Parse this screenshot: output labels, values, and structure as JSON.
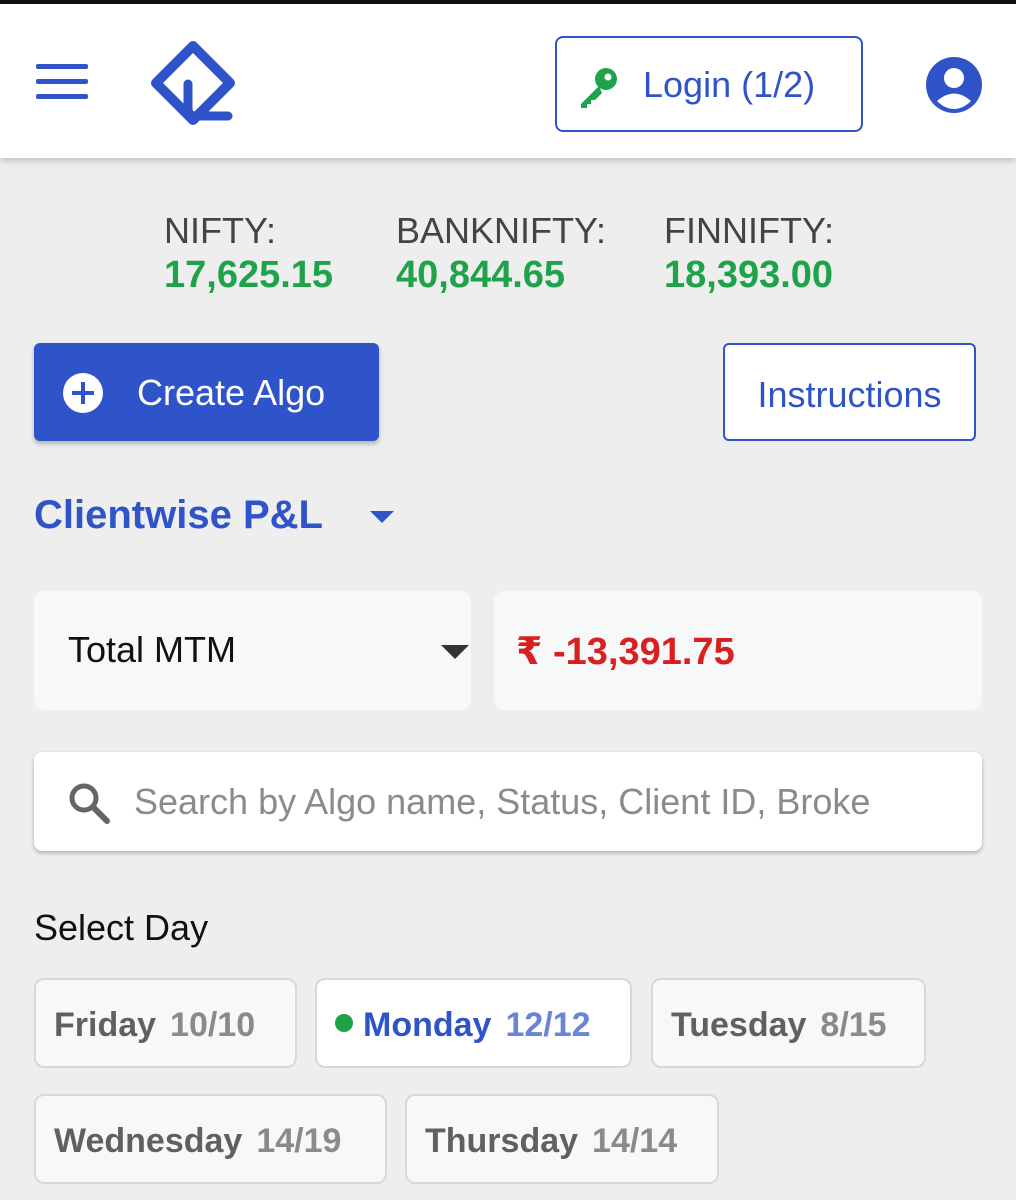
{
  "header": {
    "login_label": "Login (1/2)"
  },
  "indices": [
    {
      "name": "NIFTY:",
      "value": "17,625.15"
    },
    {
      "name": "BANKNIFTY:",
      "value": "40,844.65"
    },
    {
      "name": "FINNIFTY:",
      "value": "18,393.00"
    }
  ],
  "actions": {
    "create_algo": "Create Algo",
    "instructions": "Instructions"
  },
  "pnl_section": {
    "title": "Clientwise P&L",
    "mtm_option": "Total MTM",
    "mtm_value": "₹ -13,391.75"
  },
  "search": {
    "placeholder": "Search by Algo name, Status, Client ID, Broke"
  },
  "day_select": {
    "label": "Select Day",
    "days": [
      {
        "name": "Friday",
        "count": "10/10",
        "active": false
      },
      {
        "name": "Monday",
        "count": "12/12",
        "active": true
      },
      {
        "name": "Tuesday",
        "count": "8/15",
        "active": false
      },
      {
        "name": "Wednesday",
        "count": "14/19",
        "active": false
      },
      {
        "name": "Thursday",
        "count": "14/14",
        "active": false
      }
    ]
  },
  "colors": {
    "primary": "#2f53c8",
    "positive": "#1ea34a",
    "negative": "#d91f1f",
    "background": "#eeeeee"
  },
  "icons": [
    "menu-icon",
    "app-logo",
    "key-icon",
    "account-circle-icon",
    "plus-circle-icon",
    "caret-down-icon",
    "search-icon",
    "active-dot-icon"
  ]
}
